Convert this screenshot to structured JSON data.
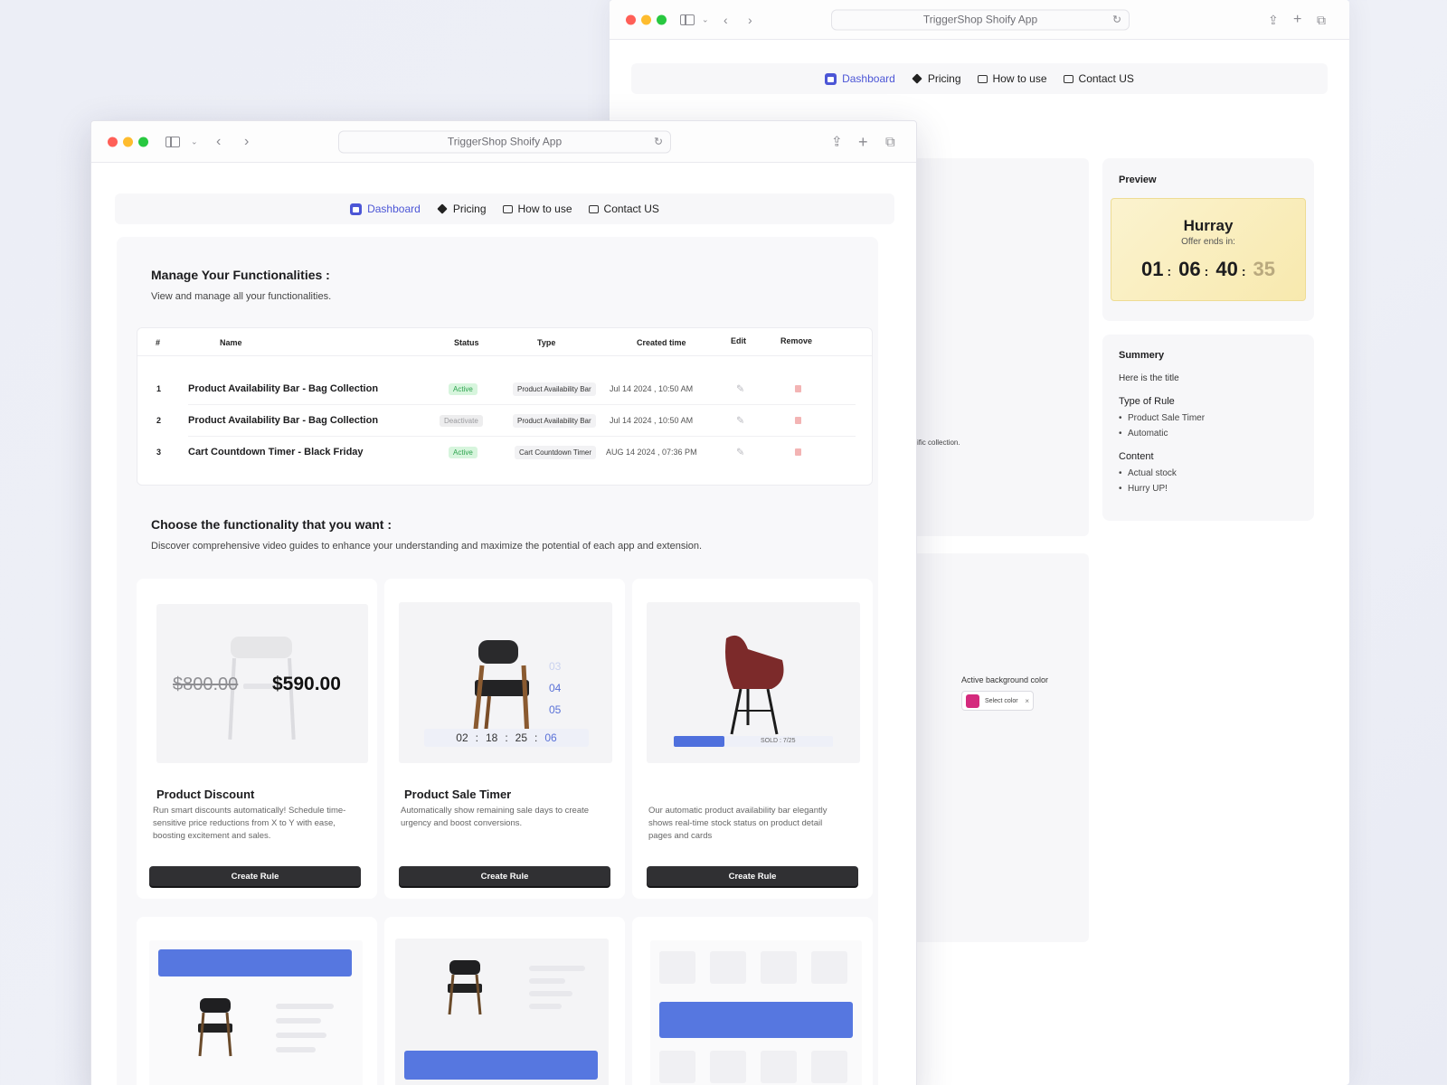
{
  "app_title": "TriggerShop Shoify App",
  "nav": [
    {
      "label": "Dashboard",
      "icon": "home-icon",
      "active": true
    },
    {
      "label": "Pricing",
      "icon": "diamond-icon",
      "active": false
    },
    {
      "label": "How to use",
      "icon": "video-icon",
      "active": false
    },
    {
      "label": "Contact US",
      "icon": "mail-icon",
      "active": false
    }
  ],
  "back_window": {
    "preview": {
      "title": "Preview",
      "headline": "Hurray",
      "subline": "Offer ends in:",
      "digits": [
        "01",
        "06",
        "40",
        "35"
      ]
    },
    "summary": {
      "title": "Summery",
      "subtitle": "Here is the title",
      "rule_heading": "Type of Rule",
      "rule_items": [
        "Product Sale Timer",
        "Automatic"
      ],
      "content_heading": "Content",
      "content_items": [
        "Actual stock",
        "Hurry UP!"
      ]
    },
    "partial_text": "ific collection.",
    "color_field": {
      "label": "Active background color",
      "placeholder": "Select color",
      "swatch": "#d42a7d"
    }
  },
  "manage": {
    "title": "Manage Your Functionalities :",
    "description": "View and manage all your functionalities.",
    "columns": [
      "#",
      "Name",
      "Status",
      "Type",
      "Created time",
      "Edit",
      "Remove"
    ],
    "rows": [
      {
        "num": "1",
        "name": "Product Availability Bar - Bag Collection",
        "status": "Active",
        "type": "Product Availability Bar",
        "created": "Jul 14 2024 , 10:50 AM"
      },
      {
        "num": "2",
        "name": "Product Availability Bar - Bag Collection",
        "status": "Deactivate",
        "type": "Product Availability Bar",
        "created": "Jul 14 2024 , 10:50 AM"
      },
      {
        "num": "3",
        "name": "Cart Countdown Timer - Black Friday",
        "status": "Active",
        "type": "Cart Countdown Timer",
        "created": "AUG 14 2024 , 07:36 PM"
      }
    ]
  },
  "choose": {
    "title": "Choose the functionality that you want :",
    "description": "Discover comprehensive video guides to enhance your understanding and maximize the potential of each app and extension.",
    "cards": [
      {
        "title": "Product Discount",
        "description": "Run smart discounts automatically! Schedule time-sensitive price reductions from X to Y with ease, boosting excitement and sales.",
        "button": "Create Rule"
      },
      {
        "title": "Product Sale Timer",
        "description": "Automatically show remaining sale days to create urgency and boost conversions.",
        "button": "Create Rule"
      },
      {
        "title": "",
        "description": "Our automatic product availability bar elegantly shows real-time stock status on product detail pages and cards",
        "button": "Create Rule"
      }
    ],
    "discount_prices": {
      "old": "$800.00",
      "new": "$590.00"
    },
    "sale_timer": {
      "digits": [
        "02",
        "18",
        "25",
        "06"
      ],
      "stack": [
        "03",
        "04",
        "05"
      ]
    },
    "availability": {
      "text": "SOLD : 7/25",
      "fill_fraction": 0.32
    }
  },
  "colors": {
    "accent": "#4c56d6",
    "active_badge": "#2ea44f",
    "button": "#303033",
    "blue_block": "#5677e0"
  }
}
